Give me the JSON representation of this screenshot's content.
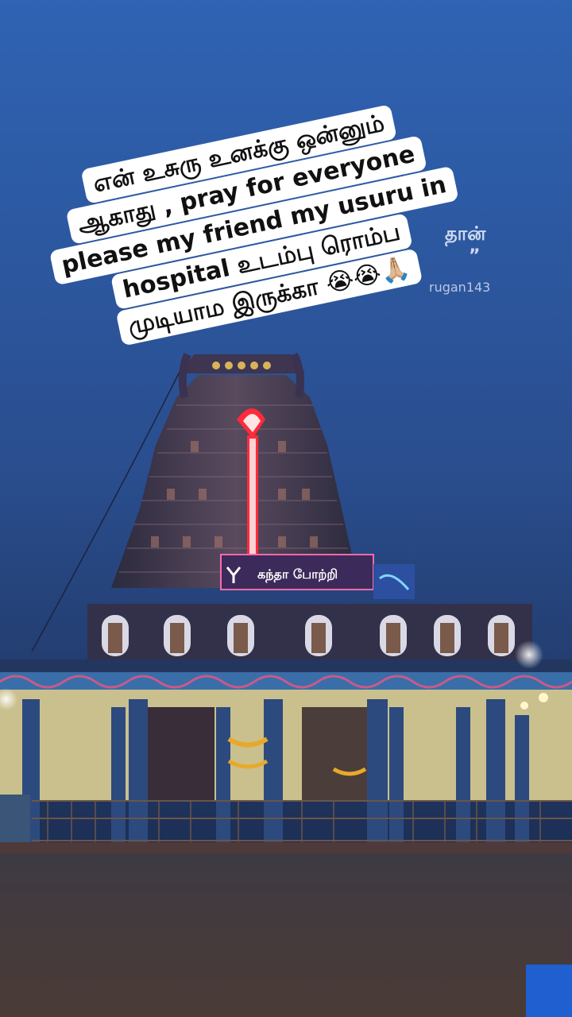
{
  "caption": {
    "lines": [
      "என் உசுரு உனக்கு ஒன்னும்",
      "ஆகாது , pray for everyone",
      "please my friend my usuru in",
      "hospital உடம்பு ரொம்ப",
      "முடியாம இருக்கா 😭😭🙏🏼"
    ]
  },
  "background_text": {
    "fragment1": "தான்",
    "fragment2": "”",
    "watermark": "rugan143"
  },
  "temple_sign": {
    "text": "கந்தா போற்றி"
  },
  "colors": {
    "sky_top": "#2f63b3",
    "sky_bottom": "#1d2f55",
    "neon_red": "#ff2b3a",
    "caption_bg": "#ffffff"
  }
}
